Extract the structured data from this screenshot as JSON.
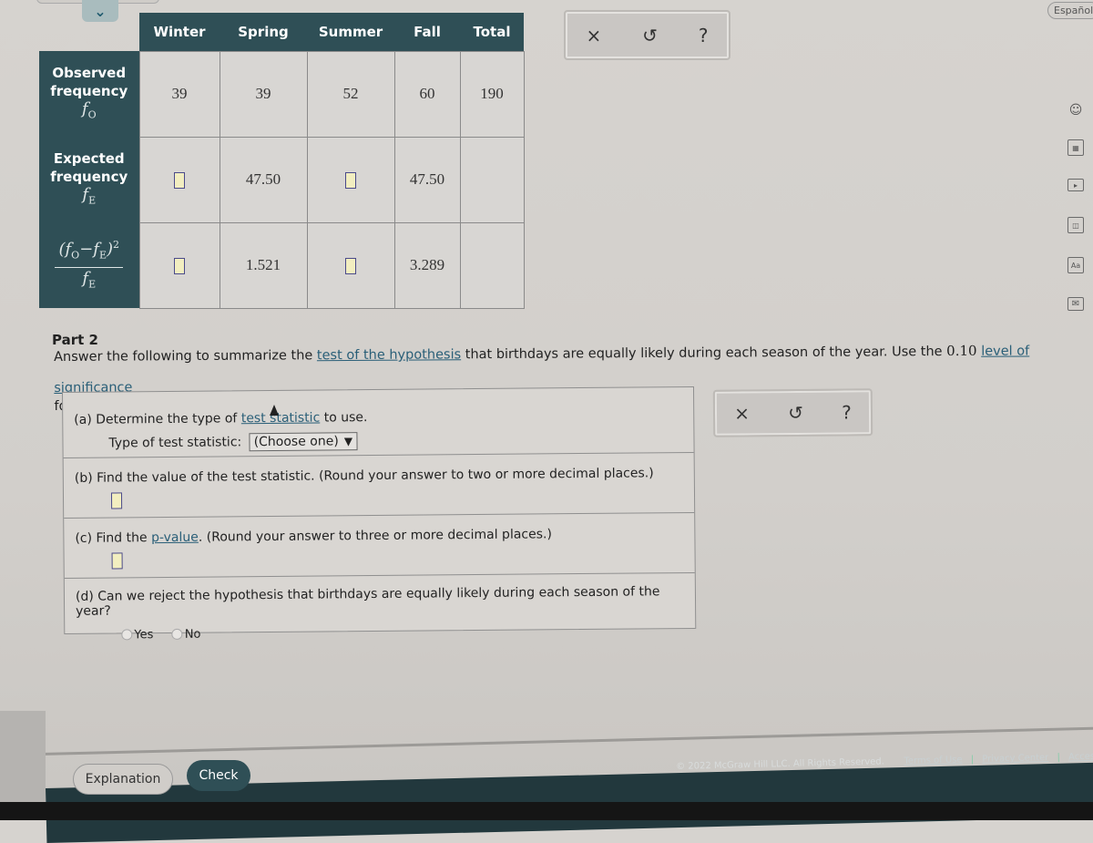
{
  "header": {
    "collapse_icon": "chevron-down-icon",
    "language_button": "Español"
  },
  "table": {
    "columns": [
      "Winter",
      "Spring",
      "Summer",
      "Fall",
      "Total"
    ],
    "rows": [
      {
        "label_line1": "Observed",
        "label_line2": "frequency",
        "symbol": "f",
        "symbol_sub": "O",
        "cells": [
          "39",
          "39",
          "52",
          "60",
          "190"
        ]
      },
      {
        "label_line1": "Expected",
        "label_line2": "frequency",
        "symbol": "f",
        "symbol_sub": "E",
        "cells": [
          "",
          "47.50",
          "",
          "47.50",
          ""
        ],
        "input_cells": [
          0,
          2
        ]
      },
      {
        "formula_num": "(fO−fE)²",
        "formula_den": "fE",
        "cells": [
          "",
          "1.521",
          "",
          "3.289",
          ""
        ],
        "input_cells": [
          0,
          2
        ]
      }
    ]
  },
  "tools_top": {
    "clear_icon": "close-icon",
    "undo_icon": "undo-icon",
    "help_icon": "help-icon",
    "clear": "×",
    "undo": "↺",
    "help": "?"
  },
  "tools_bottom": {
    "clear": "×",
    "undo": "↺",
    "help": "?"
  },
  "right_rail": {
    "icons": [
      "ask-tutor-icon",
      "calculator-icon",
      "video-icon",
      "ebook-icon",
      "glossary-icon",
      "message-icon"
    ],
    "glossary_text": "Aa"
  },
  "part2": {
    "title": "Part 2",
    "intro_before_link": "Answer the following to summarize the ",
    "intro_link": "test of the hypothesis",
    "intro_middle": " that birthdays are equally likely during each season of the year. Use the ",
    "significance": "0.10",
    "significance_link": "level of significance",
    "intro_end": "for the test."
  },
  "questions": {
    "a": {
      "prefix": "(a) Determine the type of ",
      "link": "test statistic",
      "suffix": " to use.",
      "select_label": "Type of test statistic:",
      "select_value": "(Choose one)"
    },
    "b": {
      "text": "(b) Find the value of the test statistic. (Round your answer to two or more decimal places.)",
      "value": ""
    },
    "c": {
      "prefix": "(c) Find the ",
      "link": "p-value",
      "suffix": ". (Round your answer to three or more decimal places.)",
      "value": ""
    },
    "d": {
      "text": "(d) Can we reject the hypothesis that birthdays are equally likely during each season of the year?",
      "options": [
        "Yes",
        "No"
      ],
      "selected": null
    }
  },
  "actions": {
    "explanation": "Explanation",
    "check": "Check"
  },
  "footer": {
    "copyright": "© 2022 McGraw Hill LLC. All Rights Reserved.",
    "terms": "Terms of Use",
    "privacy": "Privacy Center",
    "accessibility": "Accessibility"
  },
  "colors": {
    "header_teal": "#2f4f56",
    "link": "#2a5f78",
    "input_fill": "#f2eec0"
  }
}
